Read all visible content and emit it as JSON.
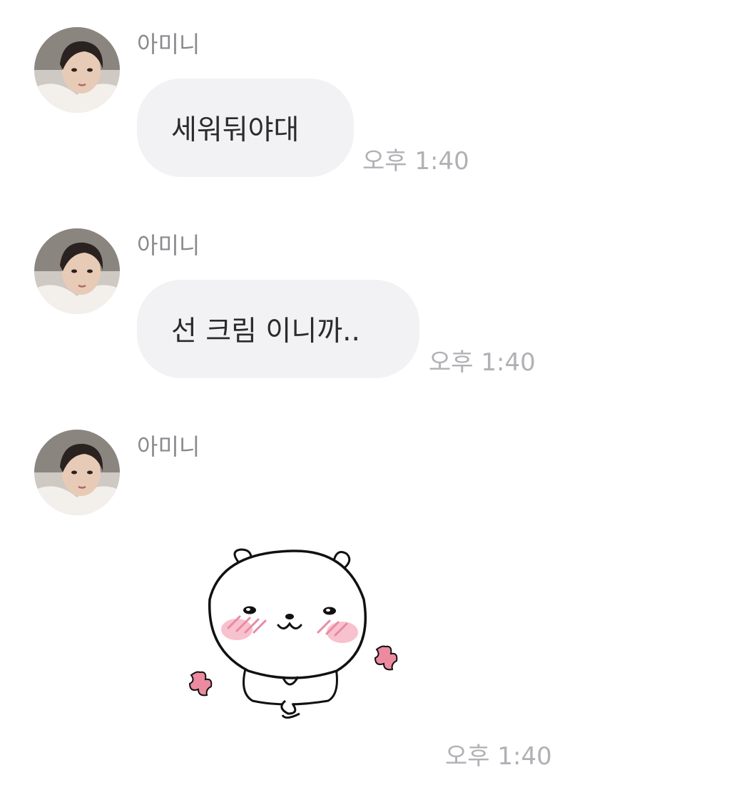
{
  "messages": [
    {
      "sender": "아미니",
      "text": "세워둬야대",
      "time": "오후 1:40"
    },
    {
      "sender": "아미니",
      "text": "선 크림 이니까..",
      "time": "오후 1:40"
    },
    {
      "sender": "아미니",
      "sticker": "blushing-bear-sticker",
      "time": "오후 1:40"
    }
  ],
  "colors": {
    "bubble": "#f2f2f5",
    "sender_text": "#8a8a8e",
    "time_text": "#b0b0b5",
    "message_text": "#2b2b2e",
    "blush": "#f4a1b4",
    "flower": "#ec8aa0"
  }
}
